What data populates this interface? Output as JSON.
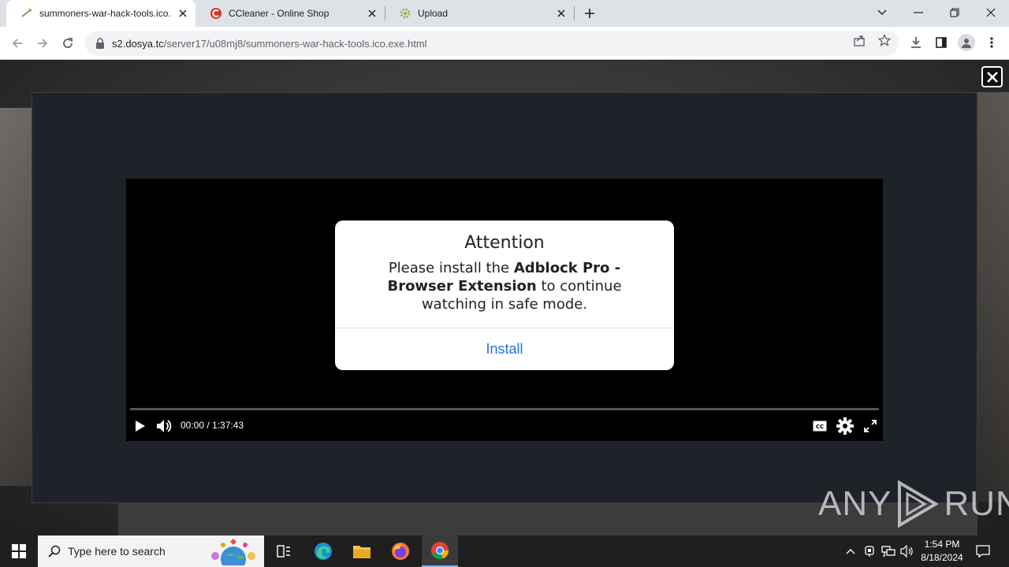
{
  "browser": {
    "tabs": [
      {
        "title": "summoners-war-hack-tools.ico.",
        "active": true,
        "favicon": "wand-icon"
      },
      {
        "title": "CCleaner - Online Shop",
        "active": false,
        "favicon": "ccleaner-icon"
      },
      {
        "title": "Upload",
        "active": false,
        "favicon": "gear-loading-icon"
      }
    ],
    "url_host": "s2.dosya.tc",
    "url_path": "/server17/u08mj8/summoners-war-hack-tools.ico.exe.html"
  },
  "video": {
    "time": "00:00 / 1:37:43"
  },
  "dialog": {
    "title": "Attention",
    "msg_pre": "Please install the ",
    "msg_bold1": "Adblock Pro - Browser Extension",
    "msg_post": " to continue watching in safe mode.",
    "install_label": "Install"
  },
  "watermark": {
    "left": "ANY",
    "right": "RUN"
  },
  "taskbar": {
    "search_placeholder": "Type here to search",
    "time": "1:54 PM",
    "date": "8/18/2024"
  },
  "colors": {
    "accent_link": "#1a73e8",
    "frame": "#1f2229"
  }
}
